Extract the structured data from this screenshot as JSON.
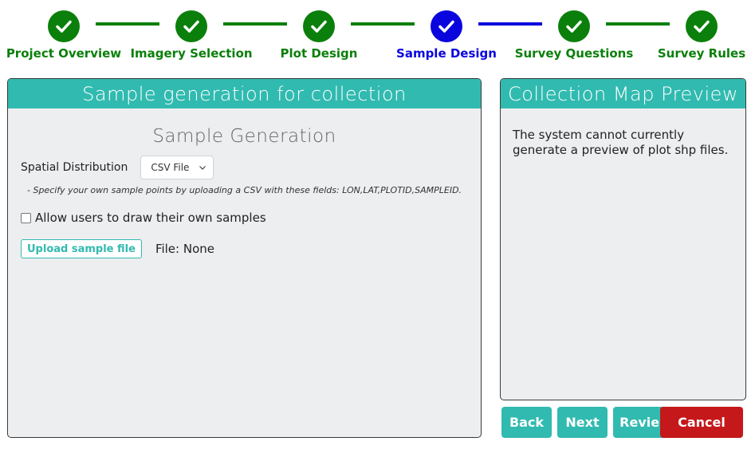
{
  "colors": {
    "done": "#0b7f0b",
    "active": "#0a05dd",
    "teal": "#31bab0",
    "danger": "#c4181a"
  },
  "steps": [
    {
      "label": "Project Overview",
      "state": "done",
      "icon": "check-icon"
    },
    {
      "label": "Imagery Selection",
      "state": "done",
      "icon": "check-icon"
    },
    {
      "label": "Plot Design",
      "state": "done",
      "icon": "check-icon"
    },
    {
      "label": "Sample Design",
      "state": "active",
      "icon": "check-icon"
    },
    {
      "label": "Survey Questions",
      "state": "done",
      "icon": "check-icon"
    },
    {
      "label": "Survey Rules",
      "state": "done",
      "icon": "check-icon"
    }
  ],
  "left_panel": {
    "title": "Sample generation for collection",
    "section_title": "Sample Generation",
    "spatial_distribution_label": "Spatial Distribution",
    "spatial_distribution_value": "CSV File",
    "hint": "- Specify your own sample points by uploading a CSV with these fields: LON,LAT,PLOTID,SAMPLEID.",
    "allow_draw_label": "Allow users to draw their own samples",
    "allow_draw_checked": false,
    "upload_button": "Upload sample file",
    "file_status": "File: None"
  },
  "right_panel": {
    "title": "Collection Map Preview",
    "message": "The system cannot currently generate a preview of plot shp files."
  },
  "buttons": {
    "back": "Back",
    "next": "Next",
    "review": "Review",
    "cancel": "Cancel"
  }
}
